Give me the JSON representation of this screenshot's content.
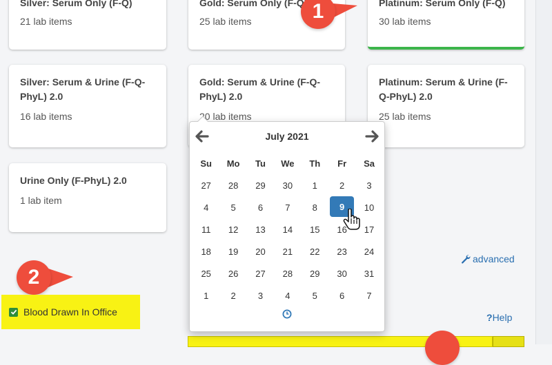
{
  "cards": [
    {
      "id": "silver-serum-only",
      "title": "Silver: Serum Only (F-Q)",
      "count": "21 lab items"
    },
    {
      "id": "gold-serum-only",
      "title": "Gold: Serum Only (F-Q)",
      "count": "25 lab items"
    },
    {
      "id": "platinum-serum-only",
      "title": "Platinum: Serum Only (F-Q)",
      "count": "30 lab items"
    },
    {
      "id": "silver-serum-urine",
      "title_line1": "Silver: Serum & Urine (F-Q-",
      "title_line2": "PhyL) 2.0",
      "count": "16 lab items"
    },
    {
      "id": "gold-serum-urine",
      "title_line1": "Gold: Serum & Urine (F-Q-",
      "title_line2": "PhyL) 2.0",
      "count": "20 lab items"
    },
    {
      "id": "platinum-serum-urine",
      "title_line1": "Platinum: Serum & Urine (F-",
      "title_line2": "Q-PhyL) 2.0",
      "count": "25 lab items"
    },
    {
      "id": "urine-only",
      "title": "Urine Only (F-PhyL) 2.0",
      "count": "1 lab item"
    }
  ],
  "badges": [
    "1",
    "2"
  ],
  "calendar": {
    "month_label": "July 2021",
    "dow": [
      "Su",
      "Mo",
      "Tu",
      "We",
      "Th",
      "Fr",
      "Sa"
    ],
    "weeks": [
      [
        "27",
        "28",
        "29",
        "30",
        "1",
        "2",
        "3"
      ],
      [
        "4",
        "5",
        "6",
        "7",
        "8",
        "9",
        "10"
      ],
      [
        "11",
        "12",
        "13",
        "14",
        "15",
        "16",
        "17"
      ],
      [
        "18",
        "19",
        "20",
        "21",
        "22",
        "23",
        "24"
      ],
      [
        "25",
        "26",
        "27",
        "28",
        "29",
        "30",
        "31"
      ],
      [
        "1",
        "2",
        "3",
        "4",
        "5",
        "6",
        "7"
      ]
    ],
    "selected_day": "9"
  },
  "advanced_label": "advanced",
  "help_label": "Help",
  "help_mark": "?",
  "blood_drawn_label": "Blood Drawn In Office",
  "blood_drawn_checked": true,
  "colors": {
    "accent": "#337ab7",
    "highlight": "#f8f214",
    "badge": "#ee4d3c",
    "selected_border": "#3cb54a"
  }
}
